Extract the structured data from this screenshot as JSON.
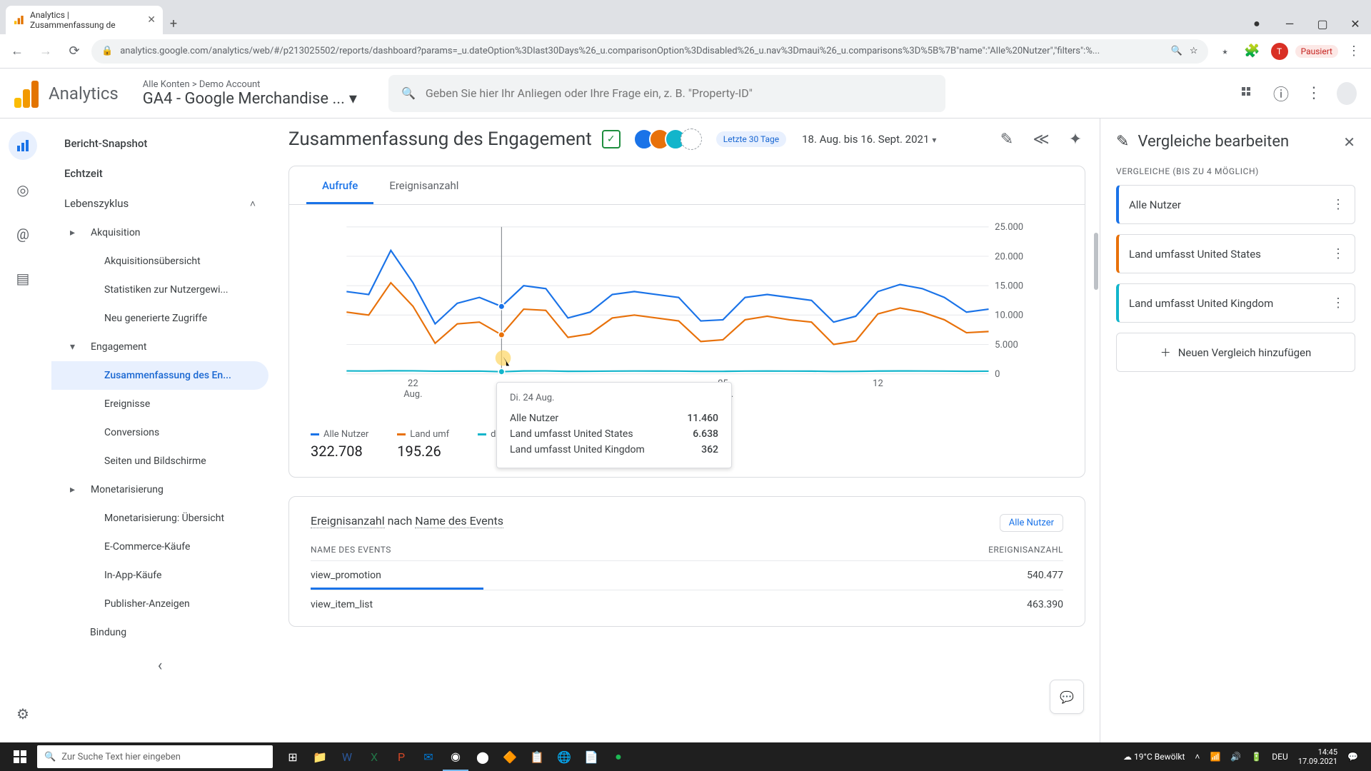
{
  "browser": {
    "tab_title": "Analytics | Zusammenfassung de",
    "url": "analytics.google.com/analytics/web/#/p213025502/reports/dashboard?params=_u.dateOption%3Dlast30Days%26_u.comparisonOption%3Ddisabled%26_u.nav%3Dmaui%26_u.comparisons%3D%5B%7B\"name\":\"Alle%20Nutzer\",\"filters\":%...",
    "pausiert": "Pausiert"
  },
  "header": {
    "app": "Analytics",
    "crumb_top": "Alle Konten > Demo Account",
    "crumb_main": "GA4 - Google Merchandise ...",
    "search_placeholder": "Geben Sie hier Ihr Anliegen oder Ihre Frage ein, z. B. \"Property-ID\""
  },
  "sidenav": {
    "snapshot": "Bericht-Snapshot",
    "realtime": "Echtzeit",
    "lifecycle": "Lebenszyklus",
    "acquisition": "Akquisition",
    "acq_overview": "Akquisitionsübersicht",
    "acq_stats": "Statistiken zur Nutzergewi...",
    "acq_new": "Neu generierte Zugriffe",
    "engagement": "Engagement",
    "eng_summary": "Zusammenfassung des En...",
    "eng_events": "Ereignisse",
    "eng_conv": "Conversions",
    "eng_pages": "Seiten und Bildschirme",
    "monet": "Monetarisierung",
    "monet_over": "Monetarisierung: Übersicht",
    "monet_ecom": "E-Commerce-Käufe",
    "monet_inapp": "In-App-Käufe",
    "monet_pub": "Publisher-Anzeigen",
    "retention": "Bindung"
  },
  "page": {
    "title": "Zusammenfassung des Engagement",
    "chip_label": "Letzte 30 Tage",
    "date_range": "18. Aug. bis 16. Sept. 2021",
    "tab1": "Aufrufe",
    "tab2": "Ereignisanzahl"
  },
  "chart_data": {
    "type": "line",
    "ylim": [
      0,
      25000
    ],
    "yticks": [
      "0",
      "5.000",
      "10.000",
      "15.000",
      "20.000",
      "25.000"
    ],
    "xticks": [
      "22 Aug.",
      "",
      "05 Sept.",
      "12"
    ],
    "series": [
      {
        "name": "Alle Nutzer",
        "color": "#1a73e8",
        "values": [
          14000,
          13500,
          21000,
          15500,
          8500,
          12000,
          13000,
          11460,
          15000,
          14500,
          9500,
          10500,
          13500,
          14000,
          13500,
          13000,
          9000,
          9200,
          13000,
          13500,
          13000,
          12500,
          8800,
          9800,
          14000,
          15200,
          14500,
          13000,
          10500,
          11000
        ]
      },
      {
        "name": "Land umfasst United States",
        "color": "#e8710a",
        "values": [
          10500,
          10000,
          15500,
          11500,
          5200,
          8500,
          8800,
          6638,
          11000,
          10800,
          6200,
          6800,
          9500,
          10000,
          9500,
          9000,
          5500,
          5800,
          9200,
          9800,
          9200,
          8800,
          5000,
          5600,
          10200,
          11200,
          10500,
          9200,
          7000,
          7200
        ]
      },
      {
        "name": "Land umfasst United Kingdom",
        "color": "#12b5cb",
        "values": [
          500,
          480,
          520,
          510,
          450,
          460,
          470,
          362,
          490,
          500,
          430,
          440,
          470,
          480,
          475,
          470,
          420,
          425,
          465,
          475,
          468,
          460,
          410,
          420,
          478,
          492,
          485,
          470,
          440,
          450
        ]
      }
    ],
    "totals": [
      "322.708",
      "195.26",
      ""
    ],
    "hover_index": 7
  },
  "tooltip": {
    "date": "Di. 24 Aug.",
    "rows": [
      {
        "label": "Alle Nutzer",
        "value": "11.460"
      },
      {
        "label": "Land umfasst United States",
        "value": "6.638"
      },
      {
        "label": "Land umfasst United Kingdom",
        "value": "362"
      }
    ]
  },
  "table": {
    "title_a": "Ereignisanzahl",
    "title_mid": " nach ",
    "title_b": "Name des Events",
    "pill": "Alle Nutzer",
    "col1": "NAME DES EVENTS",
    "col2": "EREIGNISANZAHL",
    "rows": [
      {
        "name": "view_promotion",
        "value": "540.477",
        "bar": 0.23
      },
      {
        "name": "view_item_list",
        "value": "463.390",
        "bar": 0
      }
    ]
  },
  "right": {
    "title": "Vergleiche bearbeiten",
    "sub": "Vergleiche (bis zu 4 möglich)",
    "items": [
      {
        "label": "Alle Nutzer",
        "color": "#1a73e8"
      },
      {
        "label": "Land umfasst United States",
        "color": "#e8710a"
      },
      {
        "label": "Land umfasst United Kingdom",
        "color": "#12b5cb"
      }
    ],
    "add": "Neuen Vergleich hinzufügen"
  },
  "taskbar": {
    "search": "Zur Suche Text hier eingeben",
    "weather": "19°C  Bewölkt",
    "lang": "DEU",
    "time": "14:45",
    "date": "17.09.2021"
  }
}
